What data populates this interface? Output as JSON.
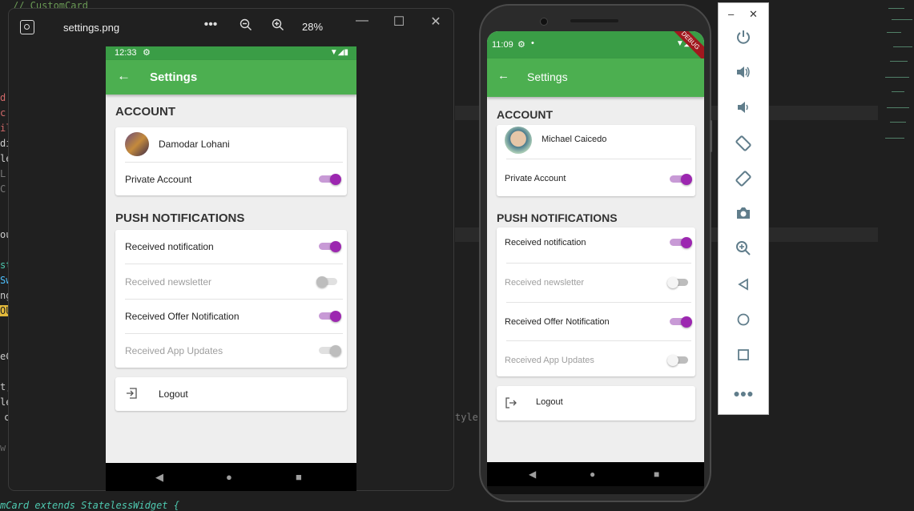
{
  "editor": {
    "fragments_left": [
      "// CustomCard",
      "d",
      "c",
      "il",
      "di",
      "le",
      "L",
      "C",
      "ou",
      "st",
      "Sw",
      "ng",
      "OU",
      "eC",
      "t,",
      "le",
      "c",
      "w."
    ],
    "fragment_mid": "tyle",
    "bottom_line": "mCard extends StatelessWidget {"
  },
  "viewer": {
    "file_name": "settings.png",
    "more_icon": "•••",
    "zoom_level": "28%",
    "minimize": "—",
    "maximize": "☐",
    "close": "✕"
  },
  "phone1": {
    "status": {
      "time": "12:33"
    },
    "app_title": "Settings",
    "account_header": "ACCOUNT",
    "user_name": "Damodar Lohani",
    "private_account": "Private Account",
    "push_header": "PUSH NOTIFICATIONS",
    "notifications": [
      {
        "label": "Received notification",
        "on": true,
        "enabled": true
      },
      {
        "label": "Received newsletter",
        "on": false,
        "enabled": false
      },
      {
        "label": "Received Offer Notification",
        "on": true,
        "enabled": true
      },
      {
        "label": "Received App Updates",
        "on": true,
        "enabled": false
      }
    ],
    "logout": "Logout"
  },
  "phone2": {
    "status": {
      "time": "11:09"
    },
    "debug_badge": "DEBUG",
    "app_title": "Settings",
    "account_header": "ACCOUNT",
    "user_name": "Michael Caicedo",
    "private_account": "Private Account",
    "push_header": "PUSH NOTIFICATIONS",
    "notifications": [
      {
        "label": "Received notification",
        "on": true,
        "enabled": true
      },
      {
        "label": "Received newsletter",
        "on": false,
        "enabled": false
      },
      {
        "label": "Received Offer Notification",
        "on": true,
        "enabled": true
      },
      {
        "label": "Received App Updates",
        "on": false,
        "enabled": false
      }
    ],
    "logout": "Logout"
  },
  "emulator": {
    "minimize": "–",
    "close": "✕",
    "buttons": [
      "power-icon",
      "volume-up-icon",
      "volume-down-icon",
      "rotate-left-icon",
      "rotate-right-icon",
      "camera-icon",
      "zoom-icon",
      "back-icon",
      "home-icon",
      "overview-icon",
      "more-icon"
    ]
  },
  "colors": {
    "app_bar": "#4caf50",
    "status_bar": "#3a9d46",
    "switch_on": "#9c27b0",
    "toolbar_icon": "#607d8b"
  }
}
